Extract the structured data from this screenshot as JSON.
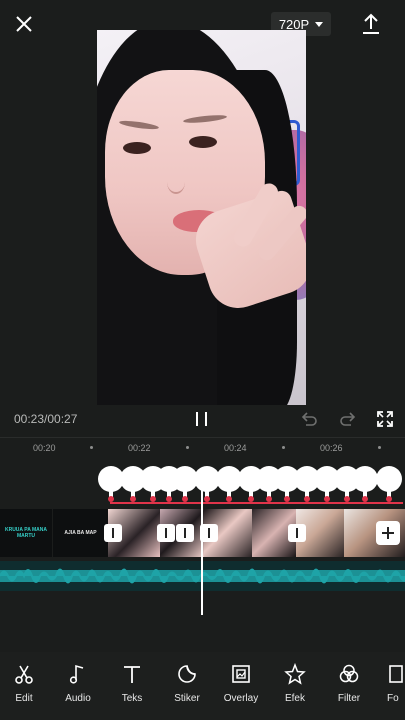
{
  "header": {
    "resolution_label": "720P",
    "close_icon": "close-icon",
    "export_icon": "upload-icon"
  },
  "player": {
    "time_display": "00:23/00:27"
  },
  "ruler": {
    "ticks": [
      "00:20",
      "00:22",
      "00:24",
      "00:26"
    ]
  },
  "clips": {
    "text_clip_1": "KRUUA PA MANA\nMARTU",
    "text_clip_2": "AJIA BA MAP"
  },
  "toolbar": {
    "items": [
      {
        "label": "Edit",
        "icon": "scissors-icon"
      },
      {
        "label": "Audio",
        "icon": "music-note-icon"
      },
      {
        "label": "Teks",
        "icon": "text-icon"
      },
      {
        "label": "Stiker",
        "icon": "sticker-icon"
      },
      {
        "label": "Overlay",
        "icon": "overlay-icon"
      },
      {
        "label": "Efek",
        "icon": "effect-star-icon"
      },
      {
        "label": "Filter",
        "icon": "filter-icon"
      },
      {
        "label": "Fo",
        "icon": "format-icon"
      }
    ]
  },
  "colors": {
    "background": "#1b1d1c",
    "accent_red": "#e0344a",
    "audio_teal": "#1fa3a7"
  }
}
